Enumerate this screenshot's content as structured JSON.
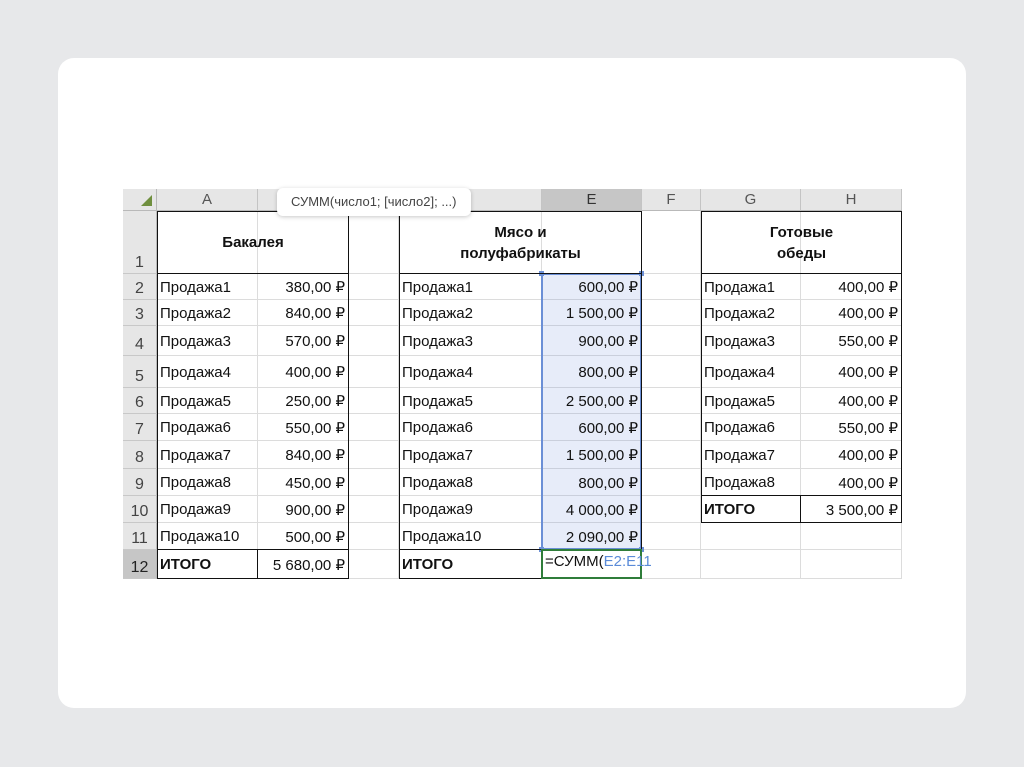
{
  "tooltip": {
    "text": "СУММ(число1; [число2]; ...)"
  },
  "columns": [
    "A",
    "",
    "",
    "",
    "E",
    "F",
    "G",
    "H"
  ],
  "rows": [
    "1",
    "2",
    "3",
    "4",
    "5",
    "6",
    "7",
    "8",
    "9",
    "10",
    "11",
    "12"
  ],
  "headers": {
    "bakaleya": "Бакалея",
    "myaso_1": "Мясо и",
    "myaso_2": "полуфабрикаты",
    "gotovye_1": "Готовые",
    "gotovye_2": "обеды"
  },
  "bakaleya": [
    {
      "label": "Продажа1",
      "value": "380,00 ₽"
    },
    {
      "label": "Продажа2",
      "value": "840,00 ₽"
    },
    {
      "label": "Продажа3",
      "value": "570,00 ₽"
    },
    {
      "label": "Продажа4",
      "value": "400,00 ₽"
    },
    {
      "label": "Продажа5",
      "value": "250,00 ₽"
    },
    {
      "label": "Продажа6",
      "value": "550,00 ₽"
    },
    {
      "label": "Продажа7",
      "value": "840,00 ₽"
    },
    {
      "label": "Продажа8",
      "value": "450,00 ₽"
    },
    {
      "label": "Продажа9",
      "value": "900,00 ₽"
    },
    {
      "label": "Продажа10",
      "value": "500,00 ₽"
    },
    {
      "label": "ИТОГО",
      "value": "5 680,00 ₽"
    }
  ],
  "myaso": [
    {
      "label": "Продажа1",
      "value": "600,00 ₽"
    },
    {
      "label": "Продажа2",
      "value": "1 500,00 ₽"
    },
    {
      "label": "Продажа3",
      "value": "900,00 ₽"
    },
    {
      "label": "Продажа4",
      "value": "800,00 ₽"
    },
    {
      "label": "Продажа5",
      "value": "2 500,00 ₽"
    },
    {
      "label": "Продажа6",
      "value": "600,00 ₽"
    },
    {
      "label": "Продажа7",
      "value": "1 500,00 ₽"
    },
    {
      "label": "Продажа8",
      "value": "800,00 ₽"
    },
    {
      "label": "Продажа9",
      "value": "4 000,00 ₽"
    },
    {
      "label": "Продажа10",
      "value": "2 090,00 ₽"
    },
    {
      "label": "ИТОГО",
      "value": ""
    }
  ],
  "gotovye": [
    {
      "label": "Продажа1",
      "value": "400,00 ₽"
    },
    {
      "label": "Продажа2",
      "value": "400,00 ₽"
    },
    {
      "label": "Продажа3",
      "value": "550,00 ₽"
    },
    {
      "label": "Продажа4",
      "value": "400,00 ₽"
    },
    {
      "label": "Продажа5",
      "value": "400,00 ₽"
    },
    {
      "label": "Продажа6",
      "value": "550,00 ₽"
    },
    {
      "label": "Продажа7",
      "value": "400,00 ₽"
    },
    {
      "label": "Продажа8",
      "value": "400,00 ₽"
    },
    {
      "label": "ИТОГО",
      "value": "3 500,00 ₽"
    }
  ],
  "formula": {
    "prefix": "=СУММ(",
    "ref": "E2:E11"
  },
  "colors": {
    "selection": "#6b8fd6",
    "active": "#2f7d3a",
    "header_bg": "#e6e6e6"
  }
}
